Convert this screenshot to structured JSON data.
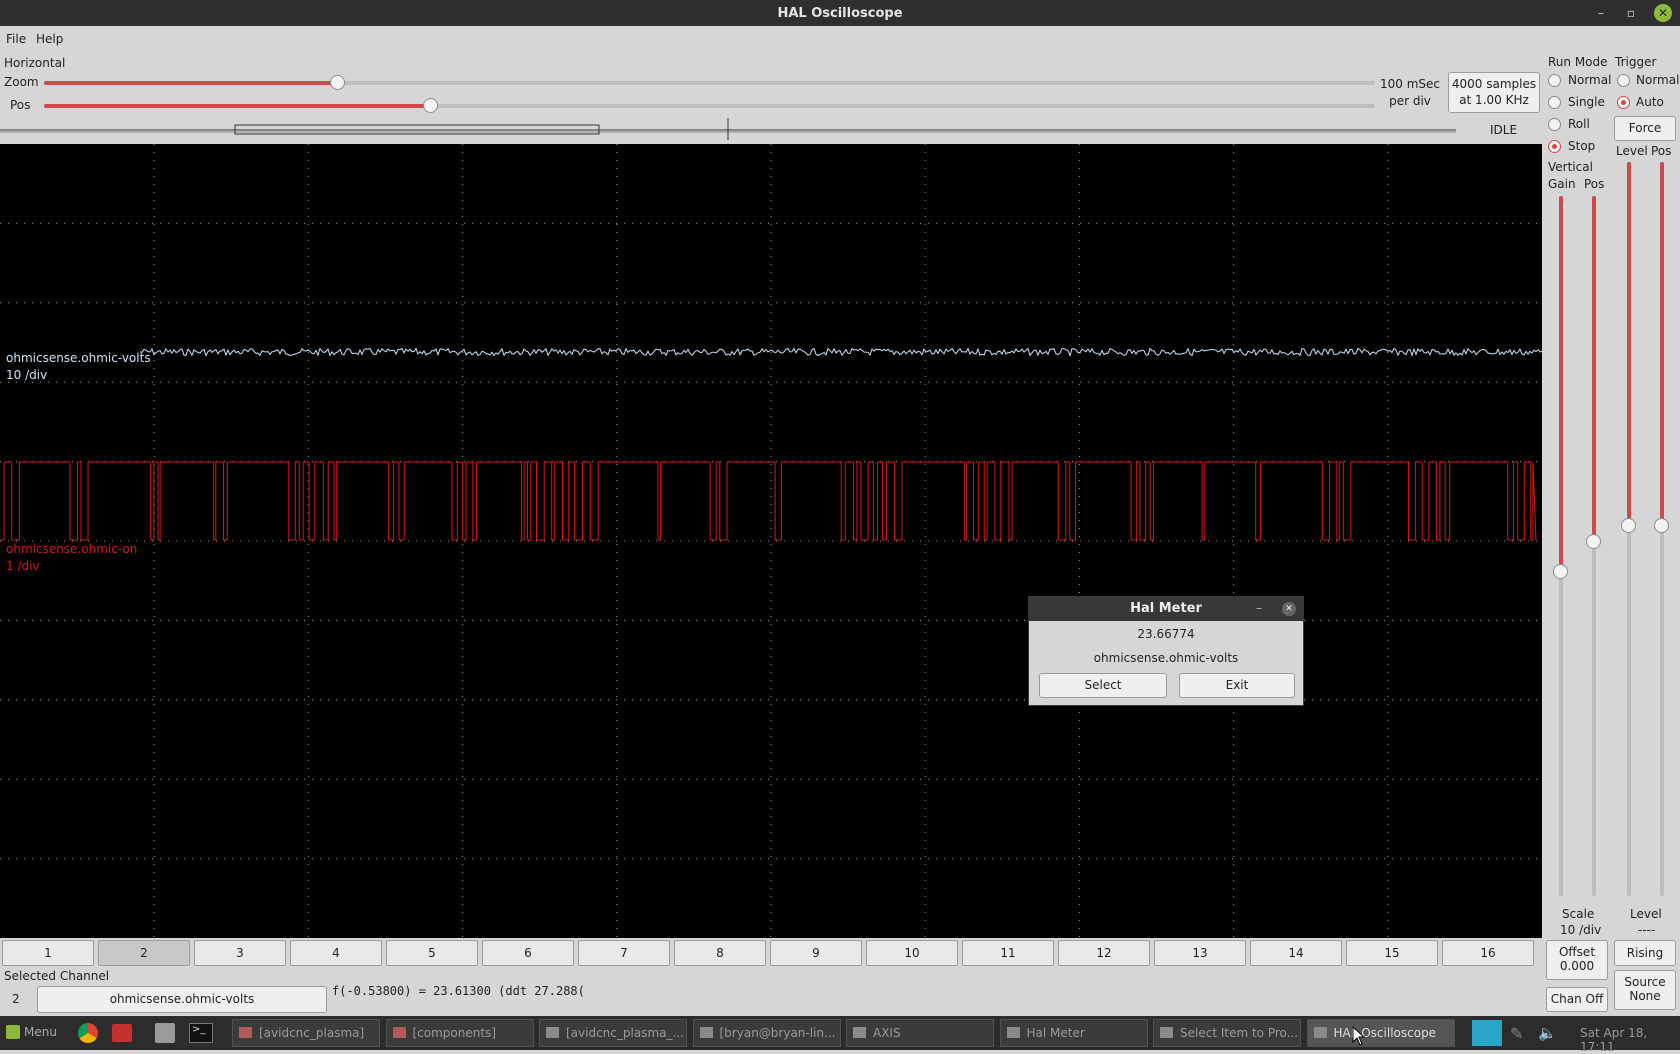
{
  "window": {
    "title": "HAL Oscilloscope"
  },
  "menu": {
    "file": "File",
    "help": "Help"
  },
  "horizontal": {
    "label": "Horizontal",
    "zoom_label": "Zoom",
    "pos_label": "Pos",
    "zoom_value": 0.22,
    "pos_value": 0.29,
    "rate_line1": "100 mSec",
    "rate_line2": "per div",
    "samples_line1": "4000 samples",
    "samples_line2": "at 1.00 KHz",
    "state": "IDLE"
  },
  "run_mode": {
    "title": "Run Mode",
    "options": [
      "Normal",
      "Single",
      "Roll",
      "Stop"
    ],
    "selected": "Stop"
  },
  "trigger": {
    "title": "Trigger",
    "options": [
      "Normal",
      "Auto"
    ],
    "selected": "Auto",
    "force": "Force",
    "level_label": "Level",
    "pos_label": "Pos",
    "level_label2": "Level",
    "level_value": "----",
    "edge": "Rising",
    "source_label": "Source",
    "source_value": "None"
  },
  "vertical": {
    "title_line1": "Vertical",
    "gain_label": "Gain",
    "pos_label": "Pos",
    "scale_label": "Scale",
    "scale_value": "10 /div",
    "offset_label": "Offset",
    "offset_value": "0.000",
    "chan_off": "Chan Off"
  },
  "traces": [
    {
      "name": "ohmicsense.ohmic-volts",
      "scale": "10 /div",
      "color": "#cfe3f7"
    },
    {
      "name": "ohmicsense.ohmic-on",
      "scale": "1 /div",
      "color": "#d81818"
    }
  ],
  "channels": [
    "1",
    "2",
    "3",
    "4",
    "5",
    "6",
    "7",
    "8",
    "9",
    "10",
    "11",
    "12",
    "13",
    "14",
    "15",
    "16"
  ],
  "selected_channel": {
    "label": "Selected Channel",
    "number": "2",
    "name": "ohmicsense.ohmic-volts",
    "readout": "f(-0.53800) =  23.61300 (ddt  27.288("
  },
  "hal_meter": {
    "title": "Hal Meter",
    "value": "23.66774",
    "pin": "ohmicsense.ohmic-volts",
    "select": "Select",
    "exit": "Exit"
  },
  "taskbar": {
    "menu": "Menu",
    "tasks": [
      "[avidcnc_plasma]",
      "[components]",
      "[avidcnc_plasma_...",
      "[bryan@bryan-lin...",
      "AXIS",
      "Hal Meter",
      "Select Item to Pro...",
      "HAL Oscilloscope"
    ],
    "clock": "Sat Apr 18, 17:11"
  }
}
